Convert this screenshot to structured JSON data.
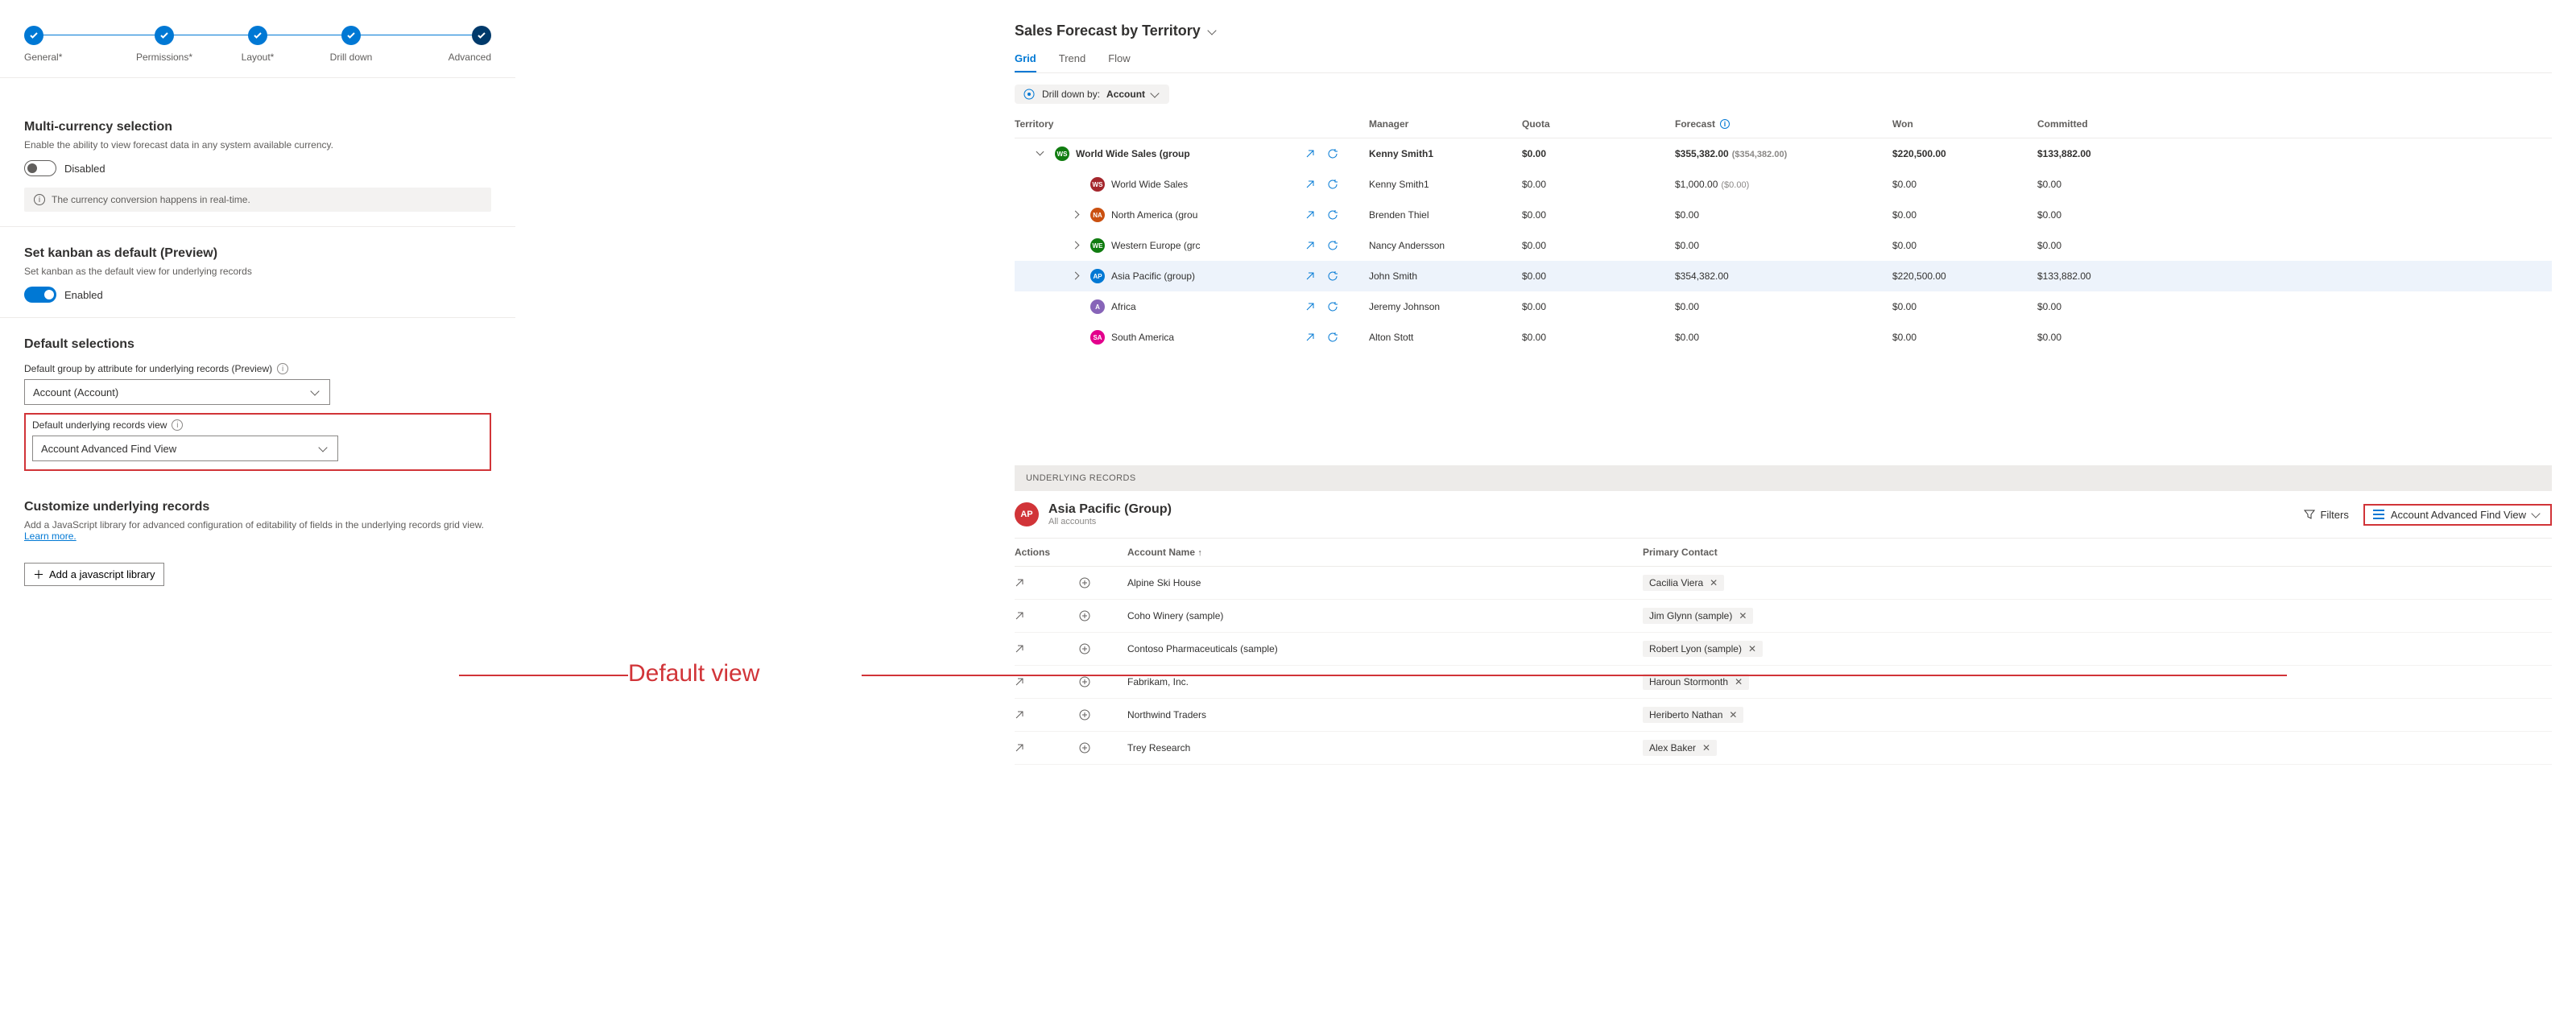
{
  "stepper": {
    "steps": [
      {
        "label": "General*"
      },
      {
        "label": "Permissions*"
      },
      {
        "label": "Layout*"
      },
      {
        "label": "Drill down"
      },
      {
        "label": "Advanced"
      }
    ]
  },
  "settings": {
    "multi_currency": {
      "title": "Multi-currency selection",
      "desc": "Enable the ability to view forecast data in any system available currency.",
      "state_label": "Disabled",
      "info": "The currency conversion happens in real-time."
    },
    "kanban": {
      "title": "Set kanban as default (Preview)",
      "desc": "Set kanban as the default view for underlying records",
      "state_label": "Enabled"
    },
    "default_selections": {
      "title": "Default selections",
      "group_by_label": "Default group by attribute for underlying records (Preview)",
      "group_by_value": "Account (Account)",
      "view_label": "Default underlying records view",
      "view_value": "Account Advanced Find View"
    },
    "customize": {
      "title": "Customize underlying records",
      "desc1": "Add a JavaScript library for advanced configuration of editability of fields in the underlying records grid view. ",
      "link": "Learn more.",
      "add_btn": "Add a javascript library"
    }
  },
  "annotation": {
    "label": "Default view"
  },
  "forecast": {
    "title": "Sales Forecast by Territory",
    "tabs": {
      "grid": "Grid",
      "trend": "Trend",
      "flow": "Flow"
    },
    "drilldown_pill": {
      "prefix": "Drill down by:",
      "value": "Account"
    },
    "columns": {
      "territory": "Territory",
      "manager": "Manager",
      "quota": "Quota",
      "forecast": "Forecast",
      "won": "Won",
      "committed": "Committed"
    },
    "rows": [
      {
        "indent": 1,
        "expand": "open",
        "avatar": "WS",
        "avColor": "#107c10",
        "name": "World Wide Sales (group",
        "bold": true,
        "manager": "Kenny Smith1",
        "quota": "$0.00",
        "forecast": "$355,382.00",
        "forecast_paren": "($354,382.00)",
        "won": "$220,500.00",
        "committed": "$133,882.00"
      },
      {
        "indent": 2,
        "expand": "none",
        "avatar": "WS",
        "avColor": "#a4262c",
        "name": "World Wide Sales",
        "manager": "Kenny Smith1",
        "quota": "$0.00",
        "forecast": "$1,000.00",
        "forecast_paren": "($0.00)",
        "won": "$0.00",
        "committed": "$0.00"
      },
      {
        "indent": 2,
        "expand": "closed",
        "avatar": "NA",
        "avColor": "#ca5010",
        "name": "North America (grou",
        "manager": "Brenden Thiel",
        "quota": "$0.00",
        "forecast": "$0.00",
        "won": "$0.00",
        "committed": "$0.00"
      },
      {
        "indent": 2,
        "expand": "closed",
        "avatar": "WE",
        "avColor": "#107c10",
        "name": "Western Europe (grc",
        "manager": "Nancy Andersson",
        "quota": "$0.00",
        "forecast": "$0.00",
        "won": "$0.00",
        "committed": "$0.00"
      },
      {
        "indent": 2,
        "expand": "closed",
        "avatar": "AP",
        "avColor": "#0078d4",
        "name": "Asia Pacific (group)",
        "selected": true,
        "manager": "John Smith",
        "quota": "$0.00",
        "forecast": "$354,382.00",
        "won": "$220,500.00",
        "committed": "$133,882.00"
      },
      {
        "indent": 2,
        "expand": "none",
        "avatar": "A",
        "avColor": "#8764b8",
        "name": "Africa",
        "manager": "Jeremy Johnson",
        "quota": "$0.00",
        "forecast": "$0.00",
        "won": "$0.00",
        "committed": "$0.00"
      },
      {
        "indent": 2,
        "expand": "none",
        "avatar": "SA",
        "avColor": "#e3008c",
        "name": "South America",
        "manager": "Alton Stott",
        "quota": "$0.00",
        "forecast": "$0.00",
        "won": "$0.00",
        "committed": "$0.00"
      }
    ]
  },
  "underlying": {
    "header": "UNDERLYING RECORDS",
    "group_avatar": "AP",
    "group_title": "Asia Pacific (Group)",
    "group_sub": "All accounts",
    "filters_label": "Filters",
    "view_label": "Account Advanced Find View",
    "columns": {
      "actions": "Actions",
      "account": "Account Name",
      "contact": "Primary Contact"
    },
    "rows": [
      {
        "account": "Alpine Ski House",
        "contact": "Cacilia Viera"
      },
      {
        "account": "Coho Winery (sample)",
        "contact": "Jim Glynn (sample)"
      },
      {
        "account": "Contoso Pharmaceuticals (sample)",
        "contact": "Robert Lyon (sample)"
      },
      {
        "account": "Fabrikam, Inc.",
        "contact": "Haroun Stormonth"
      },
      {
        "account": "Northwind Traders",
        "contact": "Heriberto Nathan"
      },
      {
        "account": "Trey Research",
        "contact": "Alex Baker"
      }
    ]
  }
}
